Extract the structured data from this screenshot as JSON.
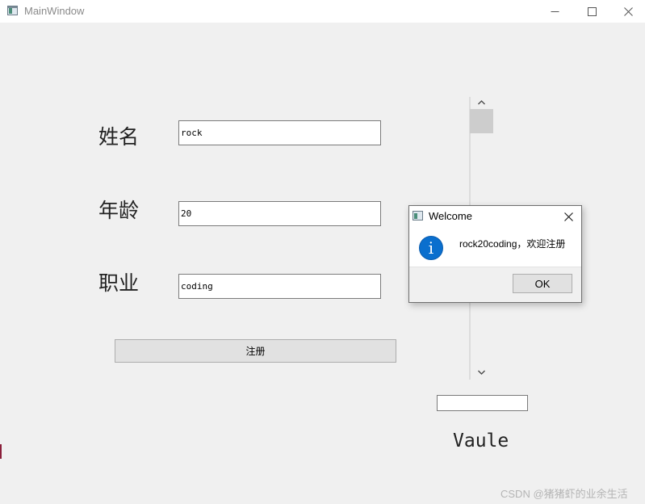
{
  "window": {
    "title": "MainWindow",
    "controls": {
      "minimize": "—",
      "maximize": "☐",
      "close": "✕"
    }
  },
  "form": {
    "name_label": "姓名",
    "name_value": "rock",
    "age_label": "年龄",
    "age_value": "20",
    "job_label": "职业",
    "job_value": "coding",
    "register_label": "注册"
  },
  "scrollbar": {
    "up_arrow": "⌃",
    "down_arrow": "⌄"
  },
  "value_panel": {
    "input_value": "",
    "label": "Vaule"
  },
  "message_box": {
    "title": "Welcome",
    "close": "✕",
    "icon": "info-icon",
    "icon_glyph": "i",
    "text": "rock20coding，欢迎注册",
    "ok_label": "OK"
  },
  "watermark": "CSDN @猪猪虾的业余生活"
}
